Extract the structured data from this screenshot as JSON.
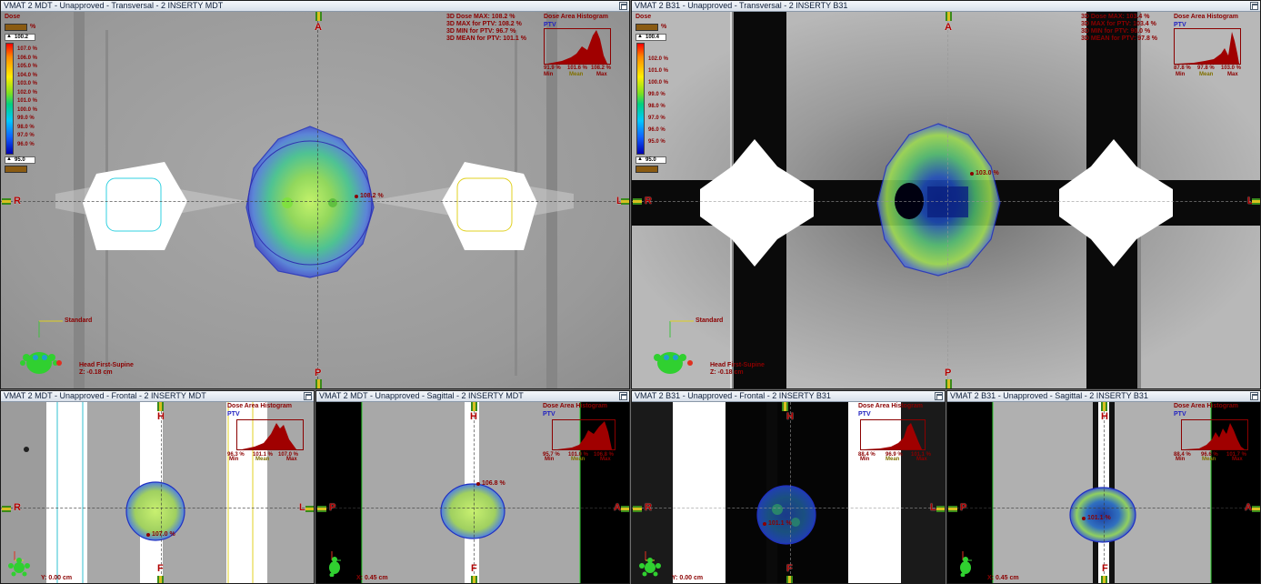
{
  "viewers": {
    "v1": {
      "title": "VMAT 2 MDT  -  Unapproved - Transversal - 2 INSERTY MDT",
      "orient": {
        "top": "A",
        "bottom": "P",
        "left": "R",
        "right": "L"
      },
      "legend": {
        "title": "Dose",
        "max": "100.2",
        "spin": "95.0",
        "unit": "%",
        "values": [
          "107.0 %",
          "106.0 %",
          "105.0 %",
          "104.0 %",
          "103.0 %",
          "102.0 %",
          "101.0 %",
          "100.0 %",
          "99.0 %",
          "98.0 %",
          "97.0 %",
          "96.0 %"
        ]
      },
      "stats": [
        "3D Dose MAX: 108.2 %",
        "3D MAX for PTV: 108.2 %",
        "3D MIN for PTV: 96.7 %",
        "3D MEAN for PTV: 101.1 %"
      ],
      "hist": {
        "title": "Dose Area Histogram",
        "struct": "PTV",
        "min": "91.9 %",
        "mean": "101.6 %",
        "max": "108.2 %",
        "labels": [
          "Min",
          "Mean",
          "Max"
        ]
      },
      "hotspot": "108.2 %",
      "patient": "Head First-Supine",
      "coord": "Z: -0.18 cm",
      "std": "Standard"
    },
    "v2": {
      "title": "VMAT 2 B31  -  Unapproved - Transversal - 2 INSERTY B31",
      "orient": {
        "top": "A",
        "bottom": "P",
        "left": "R",
        "right": "L"
      },
      "legend": {
        "title": "Dose",
        "max": "100.4",
        "spin": "95.0",
        "unit": "%",
        "values": [
          "102.0 %",
          "101.0 %",
          "100.0 %",
          "99.0 %",
          "98.0 %",
          "97.0 %",
          "96.0 %",
          "95.0 %"
        ]
      },
      "stats": [
        "3D Dose MAX: 103.4 %",
        "3D MAX for PTV: 103.4 %",
        "3D MIN for PTV: 90.0 %",
        "3D MEAN for PTV: 97.8 %"
      ],
      "hist": {
        "title": "Dose Area Histogram",
        "struct": "PTV",
        "min": "87.8 %",
        "mean": "97.8 %",
        "max": "103.0 %",
        "labels": [
          "Min",
          "Mean",
          "Max"
        ]
      },
      "hotspot": "103.0 %",
      "patient": "Head First-Supine",
      "coord": "Z: -0.18 cm",
      "std": "Standard"
    },
    "v3": {
      "title": "VMAT 2 MDT  -  Unapproved - Frontal - 2 INSERTY MDT",
      "orient": {
        "top": "H",
        "bottom": "F",
        "left": "R",
        "right": "L"
      },
      "hist": {
        "title": "Dose Area Histogram",
        "struct": "PTV",
        "min": "96.3 %",
        "mean": "101.1 %",
        "max": "107.0 %",
        "labels": [
          "Min",
          "Mean",
          "Max"
        ]
      },
      "hotspot": "107.0 %",
      "coord": "Y: 0.00 cm"
    },
    "v4": {
      "title": "VMAT 2 MDT  -  Unapproved - Sagittal - 2 INSERTY MDT",
      "orient": {
        "top": "H",
        "bottom": "F",
        "left": "P",
        "right": "A"
      },
      "hist": {
        "title": "Dose Area Histogram",
        "struct": "PTV",
        "min": "95.7 %",
        "mean": "101.0 %",
        "max": "106.8 %",
        "labels": [
          "Min",
          "Mean",
          "Max"
        ]
      },
      "hotspot": "106.8 %",
      "coord": "X: 0.45 cm"
    },
    "v5": {
      "title": "VMAT 2 B31  -  Unapproved - Frontal - 2 INSERTY B31",
      "orient": {
        "top": "H",
        "bottom": "F",
        "left": "R",
        "right": "L"
      },
      "hist": {
        "title": "Dose Area Histogram",
        "struct": "PTV",
        "min": "88.4 %",
        "mean": "96.9 %",
        "max": "101.1 %",
        "labels": [
          "Min",
          "Mean",
          "Max"
        ]
      },
      "hotspot": "101.1 %",
      "coord": "Y: 0.00 cm"
    },
    "v6": {
      "title": "VMAT 2 B31  -  Unapproved - Sagittal - 2 INSERTY B31",
      "orient": {
        "top": "H",
        "bottom": "F",
        "left": "P",
        "right": "A"
      },
      "hist": {
        "title": "Dose Area Histogram",
        "struct": "PTV",
        "min": "88.4 %",
        "mean": "96.6 %",
        "max": "101.7 %",
        "labels": [
          "Min",
          "Mean",
          "Max"
        ]
      },
      "hotspot": "101.1 %",
      "coord": "X: 0.45 cm"
    }
  },
  "colors": {
    "titlebar": "#dde5ef",
    "annotation": "#8b0000",
    "ptv": "#2020c0",
    "histFill": "#a00000"
  }
}
